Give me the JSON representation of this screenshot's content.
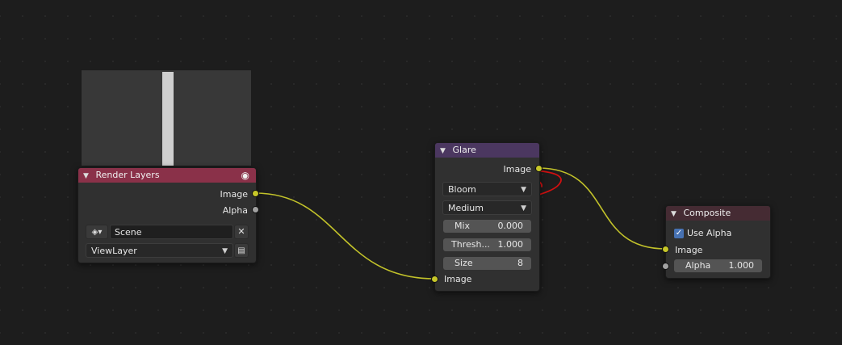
{
  "render_layers": {
    "title": "Render Layers",
    "outputs": {
      "image": "Image",
      "alpha": "Alpha"
    },
    "scene_value": "Scene",
    "view_layer_value": "ViewLayer",
    "icons": {
      "visibility": "eye-icon",
      "scene_selector": "scene-icon",
      "clear": "close-icon",
      "render": "render-icon"
    }
  },
  "glare": {
    "title": "Glare",
    "output_image": "Image",
    "glare_type": "Bloom",
    "quality": "Medium",
    "mix": {
      "label": "Mix",
      "value": "0.000"
    },
    "threshold": {
      "label": "Thresh...",
      "value": "1.000"
    },
    "size": {
      "label": "Size",
      "value": "8"
    },
    "input_image": "Image"
  },
  "composite": {
    "title": "Composite",
    "use_alpha_label": "Use Alpha",
    "use_alpha_checked": true,
    "input_image": "Image",
    "alpha": {
      "label": "Alpha",
      "value": "1.000"
    }
  },
  "colors": {
    "render_layers_header": "#8a3149",
    "glare_header": "#4b3760",
    "composite_header": "#452b33",
    "image_socket": "#c7c729",
    "value_socket": "#a1a1a1",
    "annotation": "#d11010"
  }
}
